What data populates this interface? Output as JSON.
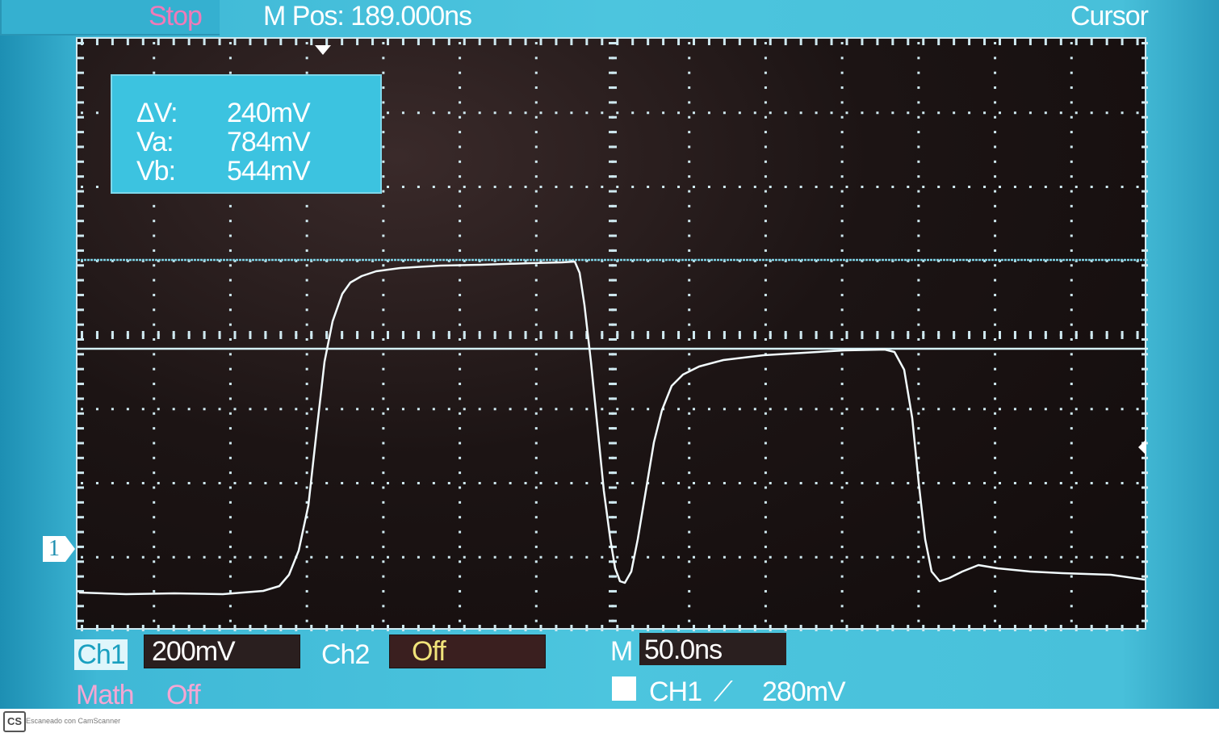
{
  "header": {
    "status": "Stop",
    "mpos": "M Pos: 189.000ns",
    "menu_title": "Cursor"
  },
  "readout": {
    "rows": [
      {
        "key": "ΔV:",
        "value": "240mV"
      },
      {
        "key": "Va:",
        "value": "784mV"
      },
      {
        "key": "Vb:",
        "value": "544mV"
      }
    ]
  },
  "markers": {
    "channel1": "1"
  },
  "footer_info": {
    "ch1_label": "Ch1",
    "ch1_scale": "200mV",
    "ch2_label": "Ch2",
    "ch2_state": "Off",
    "timebase_label": "M",
    "timebase_value": "50.0ns",
    "math_label": "Math",
    "math_state": "Off",
    "trigger_source": "CH1",
    "trigger_slope": "⟋",
    "trigger_level": "280mV"
  },
  "watermark": {
    "logo": "CS",
    "text": "Escaneado con CamScanner"
  },
  "colors": {
    "screen_bg": "#48c0da",
    "plot_bg": "#120c0c",
    "trace": "#ffffff",
    "stop_text": "#f07ab8",
    "math_text": "#f4a6d3",
    "ch2_state_text": "#f1e37a"
  }
}
